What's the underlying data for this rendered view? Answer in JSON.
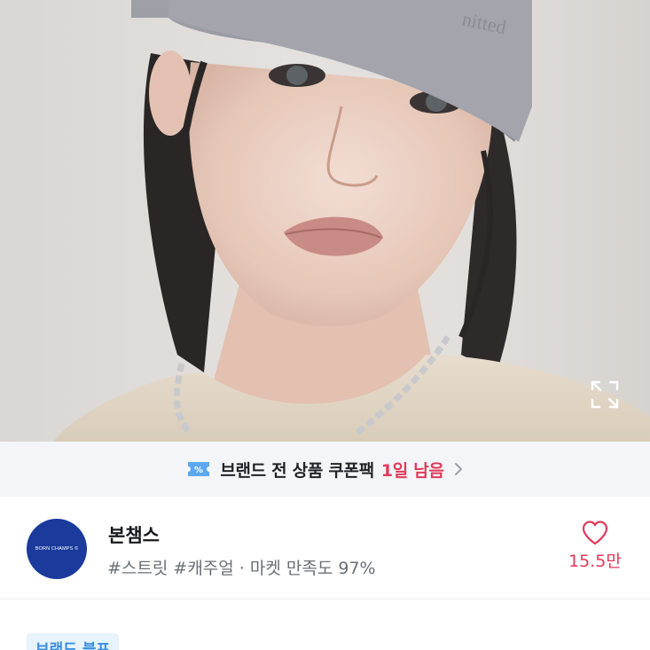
{
  "hero": {
    "expand_icon": "expand-icon"
  },
  "coupon_banner": {
    "icon": "coupon-ticket-icon",
    "text": "브랜드 전 상품 쿠폰팩",
    "time_left": "1일 남음",
    "chevron": "chevron-right-icon",
    "accent_color": "#e2395a"
  },
  "shop": {
    "logo_text": "BORN CHAMPS ©",
    "name": "본챔스",
    "tags": "#스트릿 #캐주얼 · 마켓 만족도 97%",
    "like_icon": "heart-outline-icon",
    "like_count": "15.5만"
  },
  "brand_badge": {
    "label": "브랜드 블프"
  }
}
